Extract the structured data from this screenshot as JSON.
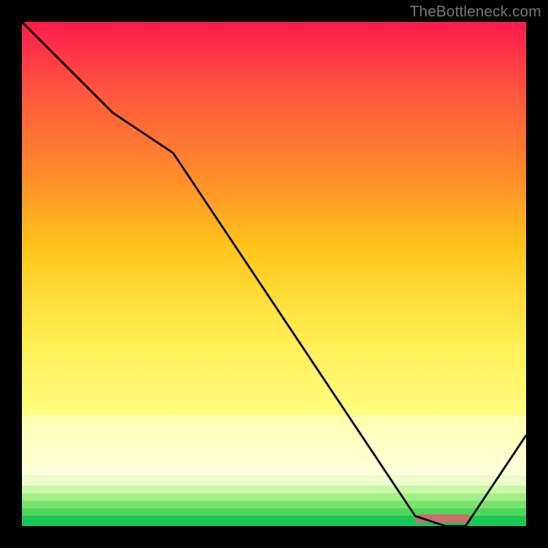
{
  "watermark": "TheBottleneck.com",
  "chart_data": {
    "type": "line",
    "title": "",
    "xlabel": "",
    "ylabel": "",
    "xlim": [
      0,
      100
    ],
    "ylim": [
      0,
      100
    ],
    "x": [
      0,
      18,
      30,
      78,
      84,
      88,
      100
    ],
    "values": [
      100,
      82,
      74,
      2,
      0,
      0,
      18
    ],
    "valley_marker": {
      "x_start": 78,
      "x_end": 89,
      "y": 1.5
    },
    "background_bands": [
      {
        "from": 0,
        "to": 60,
        "gradient": [
          "#ff1a4d",
          "#ff5a3c",
          "#ff8a2a",
          "#ffc61a",
          "#ffe94a"
        ],
        "label": "red-to-yellow"
      },
      {
        "from": 60,
        "to": 78,
        "gradient": [
          "#ffe94a",
          "#ffff80"
        ],
        "label": "yellow"
      },
      {
        "from": 78,
        "to": 90,
        "gradient": [
          "#ffffb0",
          "#ffffdd"
        ],
        "label": "pale-yellow"
      },
      {
        "from": 90,
        "to": 92,
        "color": "#ecfccb",
        "label": "pale-green-1"
      },
      {
        "from": 92,
        "to": 93.5,
        "color": "#caf7a8",
        "label": "pale-green-2"
      },
      {
        "from": 93.5,
        "to": 95,
        "color": "#a4ef87",
        "label": "green-3"
      },
      {
        "from": 95,
        "to": 96.5,
        "color": "#7be36b",
        "label": "green-4"
      },
      {
        "from": 96.5,
        "to": 98,
        "color": "#4fd65a",
        "label": "green-5"
      },
      {
        "from": 98,
        "to": 100,
        "color": "#18c756",
        "label": "green-6"
      }
    ],
    "line_color": "#000000",
    "line_width": 3
  }
}
